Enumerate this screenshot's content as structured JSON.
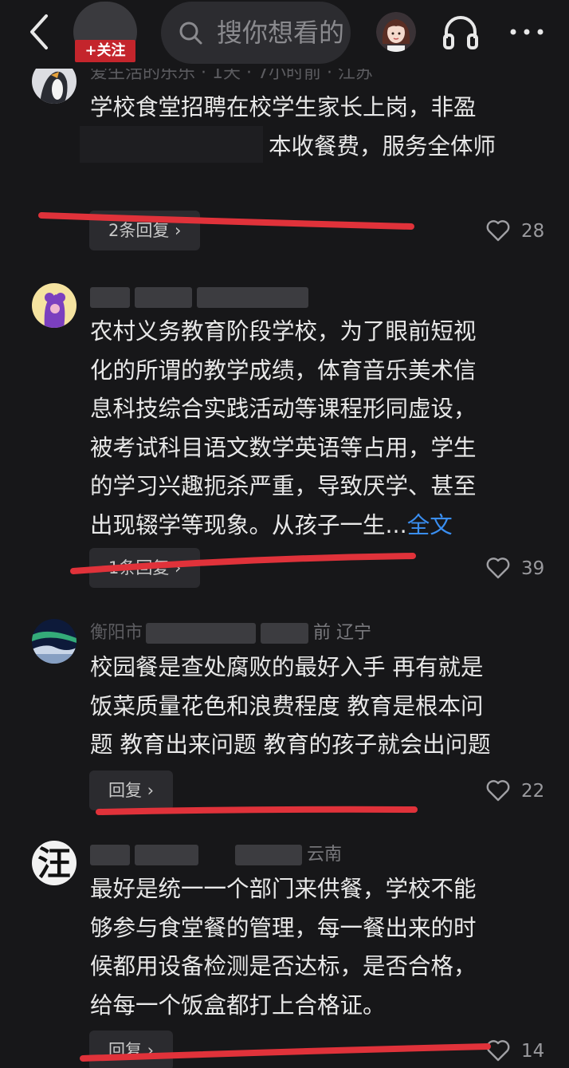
{
  "header": {
    "follow_label": "+关注",
    "search_placeholder": "搜你想看的"
  },
  "comments": [
    {
      "meta": "爱生活的乐乐 · 1天 · 7小时前 · 江苏",
      "lines": [
        "学校食堂招聘在校学生家长上岗，非盈",
        "本收餐费，服务全体师"
      ],
      "reply_label": "2条回复 ›",
      "likes": "28"
    },
    {
      "meta": "",
      "lines": [
        "农村义务教育阶段学校，为了眼前短视",
        "化的所谓的教学成绩，体育音乐美术信",
        "息科技综合实践活动等课程形同虚设，",
        "被考试科目语文数学英语等占用，学生",
        "的学习兴趣扼杀严重，导致厌学、甚至",
        "出现辍学等现象。从孩子一生..."
      ],
      "full_text_label": "全文",
      "reply_label": "1条回复 ›",
      "likes": "39"
    },
    {
      "meta_left": "衡阳市",
      "meta_right": "前  辽宁",
      "lines": [
        "校园餐是查处腐败的最好入手 再有就是",
        "饭菜质量花色和浪费程度 教育是根本问",
        "题 教育出来问题 教育的孩子就会出问题"
      ],
      "reply_label": "回复 ›",
      "likes": "22"
    },
    {
      "meta_right": "云南",
      "avatar_text": "汪",
      "lines": [
        "最好是统一一个部门来供餐，学校不能",
        "够参与食堂餐的管理，每一餐出来的时",
        "候都用设备检测是否达标，是否合格，",
        "给每一个饭盒都打上合格证。"
      ],
      "reply_label": "回复 ›",
      "likes": "14"
    }
  ],
  "colors": {
    "background": "#171719",
    "follow_red": "#c4252c",
    "link_blue": "#3a8ef0",
    "annotation_red": "#e0323a"
  }
}
